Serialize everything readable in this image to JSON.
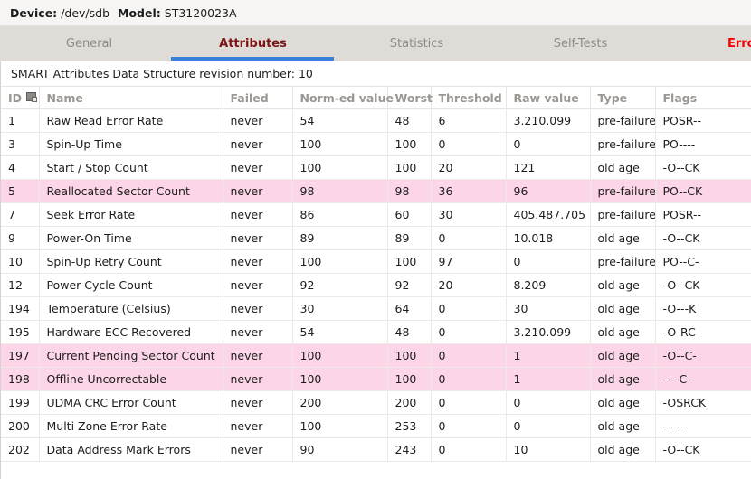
{
  "device_bar": {
    "device_label": "Device:",
    "device_value": "/dev/sdb",
    "model_label": "Model:",
    "model_value": "ST3120023A"
  },
  "tabs": [
    {
      "id": "general",
      "label": "General",
      "state": "inactive"
    },
    {
      "id": "attributes",
      "label": "Attributes",
      "state": "active"
    },
    {
      "id": "statistics",
      "label": "Statistics",
      "state": "inactive"
    },
    {
      "id": "self-tests",
      "label": "Self-Tests",
      "state": "inactive"
    },
    {
      "id": "error",
      "label": "Error",
      "state": "error"
    }
  ],
  "colors": {
    "active_tab_text": "#7b1414",
    "active_tab_underline": "#3a7fdb",
    "inactive_tab_text": "#8f8b86",
    "error_tab_text": "#f50000",
    "tabbar_background": "#dfdcd8",
    "device_bar_background": "#f6f5f4",
    "warn_row_background": "#fcd6e8",
    "header_text": "#9a9792"
  },
  "revision_line": "SMART Attributes Data Structure revision number: 10",
  "table": {
    "sort_icon_name": "column-sort-icon",
    "columns": [
      {
        "key": "id",
        "label": "ID"
      },
      {
        "key": "name",
        "label": "Name"
      },
      {
        "key": "failed",
        "label": "Failed"
      },
      {
        "key": "normed",
        "label": "Norm-ed value"
      },
      {
        "key": "worst",
        "label": "Worst"
      },
      {
        "key": "threshold",
        "label": "Threshold"
      },
      {
        "key": "raw",
        "label": "Raw value"
      },
      {
        "key": "type",
        "label": "Type"
      },
      {
        "key": "flags",
        "label": "Flags"
      }
    ],
    "rows": [
      {
        "id": "1",
        "name": "Raw Read Error Rate",
        "failed": "never",
        "normed": "54",
        "worst": "48",
        "threshold": "6",
        "raw": "3.210.099",
        "type": "pre-failure",
        "flags": "POSR--",
        "warn": false
      },
      {
        "id": "3",
        "name": "Spin-Up Time",
        "failed": "never",
        "normed": "100",
        "worst": "100",
        "threshold": "0",
        "raw": "0",
        "type": "pre-failure",
        "flags": "PO----",
        "warn": false
      },
      {
        "id": "4",
        "name": "Start / Stop Count",
        "failed": "never",
        "normed": "100",
        "worst": "100",
        "threshold": "20",
        "raw": "121",
        "type": "old age",
        "flags": "-O--CK",
        "warn": false
      },
      {
        "id": "5",
        "name": "Reallocated Sector Count",
        "failed": "never",
        "normed": "98",
        "worst": "98",
        "threshold": "36",
        "raw": "96",
        "type": "pre-failure",
        "flags": "PO--CK",
        "warn": true
      },
      {
        "id": "7",
        "name": "Seek Error Rate",
        "failed": "never",
        "normed": "86",
        "worst": "60",
        "threshold": "30",
        "raw": "405.487.705",
        "type": "pre-failure",
        "flags": "POSR--",
        "warn": false
      },
      {
        "id": "9",
        "name": "Power-On Time",
        "failed": "never",
        "normed": "89",
        "worst": "89",
        "threshold": "0",
        "raw": "10.018",
        "type": "old age",
        "flags": "-O--CK",
        "warn": false
      },
      {
        "id": "10",
        "name": "Spin-Up Retry Count",
        "failed": "never",
        "normed": "100",
        "worst": "100",
        "threshold": "97",
        "raw": "0",
        "type": "pre-failure",
        "flags": "PO--C-",
        "warn": false
      },
      {
        "id": "12",
        "name": "Power Cycle Count",
        "failed": "never",
        "normed": "92",
        "worst": "92",
        "threshold": "20",
        "raw": "8.209",
        "type": "old age",
        "flags": "-O--CK",
        "warn": false
      },
      {
        "id": "194",
        "name": "Temperature (Celsius)",
        "failed": "never",
        "normed": "30",
        "worst": "64",
        "threshold": "0",
        "raw": "30",
        "type": "old age",
        "flags": "-O---K",
        "warn": false
      },
      {
        "id": "195",
        "name": "Hardware ECC Recovered",
        "failed": "never",
        "normed": "54",
        "worst": "48",
        "threshold": "0",
        "raw": "3.210.099",
        "type": "old age",
        "flags": "-O-RC-",
        "warn": false
      },
      {
        "id": "197",
        "name": "Current Pending Sector Count",
        "failed": "never",
        "normed": "100",
        "worst": "100",
        "threshold": "0",
        "raw": "1",
        "type": "old age",
        "flags": "-O--C-",
        "warn": true
      },
      {
        "id": "198",
        "name": "Offline Uncorrectable",
        "failed": "never",
        "normed": "100",
        "worst": "100",
        "threshold": "0",
        "raw": "1",
        "type": "old age",
        "flags": "----C-",
        "warn": true
      },
      {
        "id": "199",
        "name": "UDMA CRC Error Count",
        "failed": "never",
        "normed": "200",
        "worst": "200",
        "threshold": "0",
        "raw": "0",
        "type": "old age",
        "flags": "-OSRCK",
        "warn": false
      },
      {
        "id": "200",
        "name": "Multi Zone Error Rate",
        "failed": "never",
        "normed": "100",
        "worst": "253",
        "threshold": "0",
        "raw": "0",
        "type": "old age",
        "flags": "------",
        "warn": false
      },
      {
        "id": "202",
        "name": "Data Address Mark Errors",
        "failed": "never",
        "normed": "90",
        "worst": "243",
        "threshold": "0",
        "raw": "10",
        "type": "old age",
        "flags": "-O--CK",
        "warn": false
      }
    ]
  }
}
